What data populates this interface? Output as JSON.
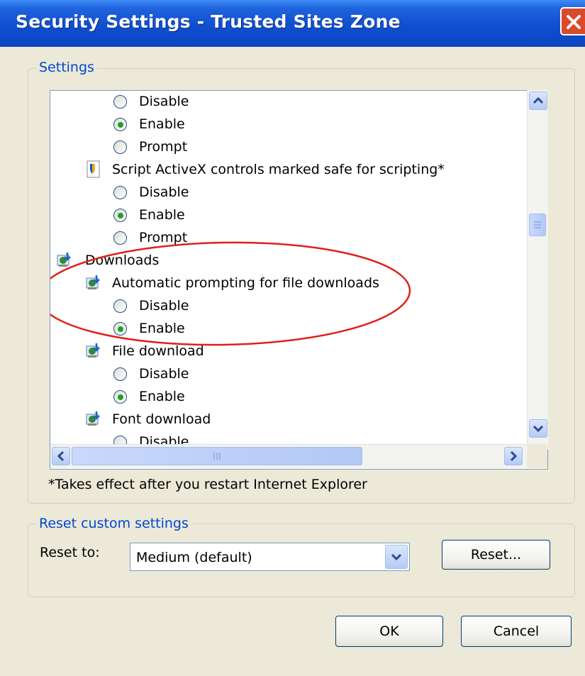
{
  "window": {
    "title": "Security Settings - Trusted Sites Zone"
  },
  "settings_group": {
    "legend": "Settings"
  },
  "settings_list": {
    "items": [
      {
        "kind": "radio",
        "label": "Disable",
        "checked": false
      },
      {
        "kind": "radio",
        "label": "Enable",
        "checked": true
      },
      {
        "kind": "radio",
        "label": "Prompt",
        "checked": false
      },
      {
        "kind": "setting",
        "label": "Script ActiveX controls marked safe for scripting*",
        "icon": "activex-script-icon"
      },
      {
        "kind": "radio",
        "label": "Disable",
        "checked": false
      },
      {
        "kind": "radio",
        "label": "Enable",
        "checked": true
      },
      {
        "kind": "radio",
        "label": "Prompt",
        "checked": false
      },
      {
        "kind": "category",
        "label": "Downloads",
        "icon": "downloads-icon"
      },
      {
        "kind": "setting",
        "label": "Automatic prompting for file downloads",
        "icon": "download-setting-icon"
      },
      {
        "kind": "radio",
        "label": "Disable",
        "checked": false
      },
      {
        "kind": "radio",
        "label": "Enable",
        "checked": true
      },
      {
        "kind": "setting",
        "label": "File download",
        "icon": "download-setting-icon"
      },
      {
        "kind": "radio",
        "label": "Disable",
        "checked": false
      },
      {
        "kind": "radio",
        "label": "Enable",
        "checked": true
      },
      {
        "kind": "setting",
        "label": "Font download",
        "icon": "download-setting-icon"
      },
      {
        "kind": "radio",
        "label": "Disable",
        "checked": false
      }
    ],
    "highlight_color": "#e0201a"
  },
  "note": "*Takes effect after you restart Internet Explorer",
  "reset_group": {
    "legend": "Reset custom settings",
    "reset_to_label": "Reset to:",
    "reset_to_value": "Medium (default)",
    "reset_button": "Reset..."
  },
  "buttons": {
    "ok": "OK",
    "cancel": "Cancel"
  },
  "colors": {
    "title_bar": "#0f4fd0",
    "dialog_bg": "#ece9d8",
    "legend_text": "#0046d5",
    "radio_dot": "#21a121"
  }
}
